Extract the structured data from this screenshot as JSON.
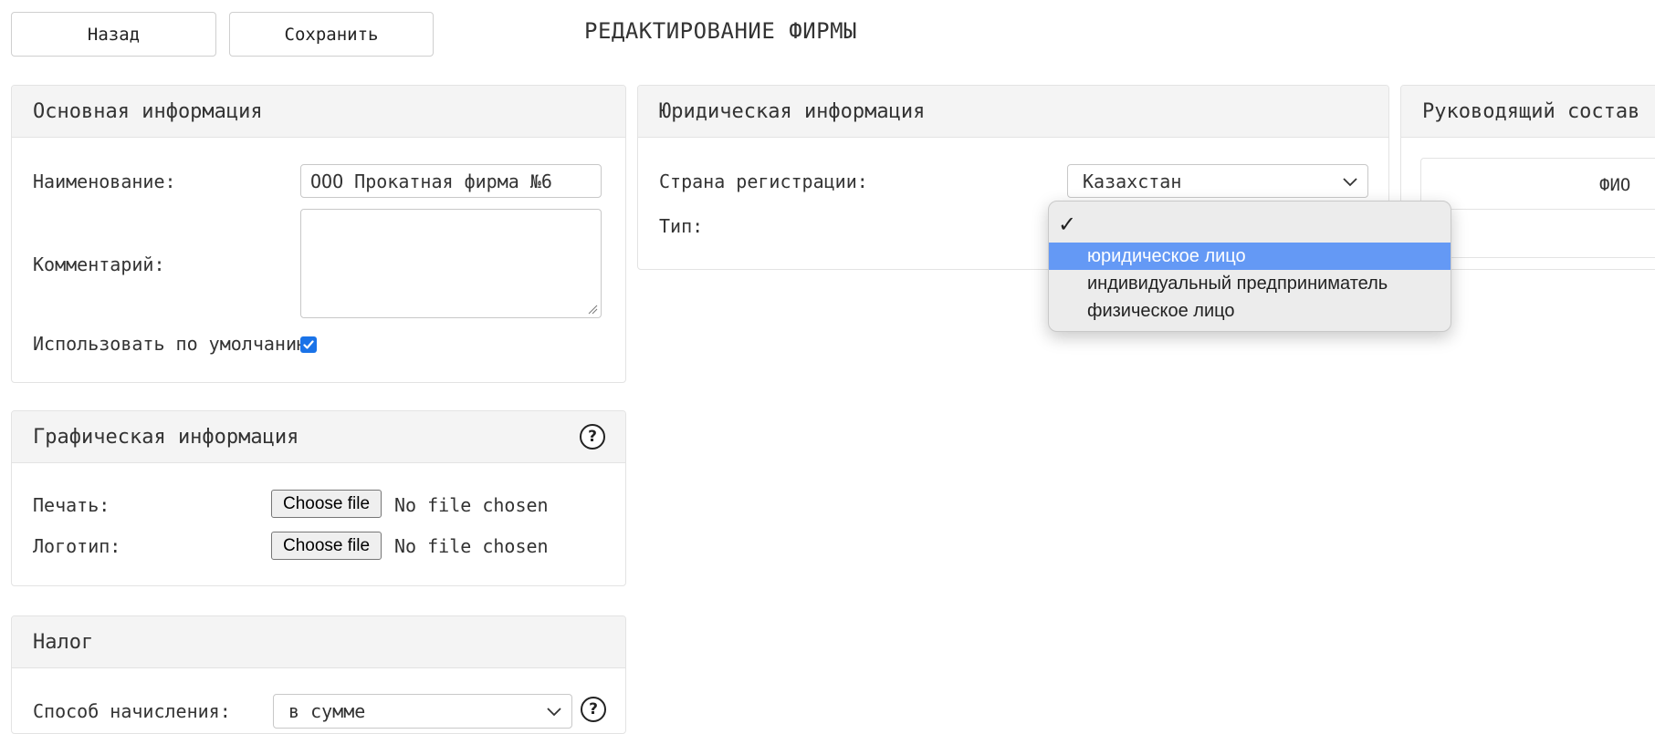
{
  "toolbar": {
    "back_label": "Назад",
    "save_label": "Сохранить"
  },
  "page_title": "РЕДАКТИРОВАНИЕ ФИРМЫ",
  "basic_info": {
    "title": "Основная информация",
    "name_label": "Наименование:",
    "name_value": "ООО Прокатная фирма №6",
    "comment_label": "Комментарий:",
    "comment_value": "",
    "default_label": "Использовать по умолчанию:",
    "default_checked": true
  },
  "graphic_info": {
    "title": "Графическая информация",
    "help": "?",
    "stamp_label": "Печать:",
    "logo_label": "Логотип:",
    "choose_file_label": "Choose file",
    "no_file_label": "No file chosen"
  },
  "tax": {
    "title": "Налог",
    "help": "?",
    "method_label": "Способ начисления:",
    "method_value": "в сумме"
  },
  "legal_info": {
    "title": "Юридическая информация",
    "country_label": "Страна регистрации:",
    "country_value": "Казахстан",
    "type_label": "Тип:"
  },
  "type_dropdown": {
    "options": [
      {
        "label": "",
        "checked": true
      },
      {
        "label": "юридическое лицо",
        "highlighted": true
      },
      {
        "label": "индивидуальный предприниматель"
      },
      {
        "label": "физическое лицо"
      }
    ]
  },
  "management": {
    "title": "Руководящий состав",
    "column_fio": "ФИО"
  },
  "colors": {
    "accent": "#1a73e8",
    "dropdown_highlight": "#6499f5",
    "panel_header_bg": "#f4f4f4"
  }
}
